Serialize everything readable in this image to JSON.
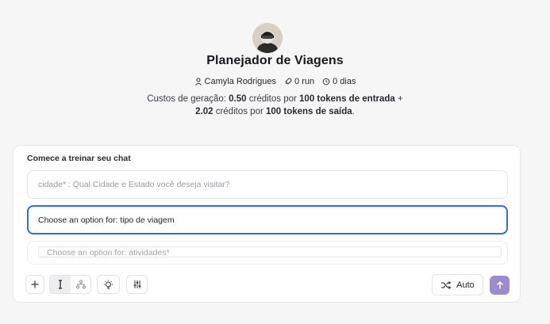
{
  "header": {
    "title": "Planejador de Viagens",
    "author": "Camyla Rodrigues",
    "runs": "0 run",
    "days": "0 dias",
    "cost": {
      "prefix": "Custos de geração: ",
      "input_amount": "0.50",
      "mid1": " créditos por ",
      "input_tokens": "100 tokens de entrada",
      "plus": " +",
      "output_amount": "2.02",
      "mid2": " créditos por ",
      "output_tokens": "100 tokens de saída",
      "suffix": "."
    }
  },
  "chat": {
    "heading": "Comece a treinar seu chat",
    "fields": {
      "cidade": "cidade* : Qual Cidade e Estado você deseja visitar?",
      "tipo": "Choose an option for: tipo de viagem",
      "atividades": "Choose an option for: atividades*"
    },
    "toolbar": {
      "mode_label": "Auto"
    }
  },
  "colors": {
    "accent": "#2f6fcf",
    "send_button": "#9d8ccd"
  }
}
